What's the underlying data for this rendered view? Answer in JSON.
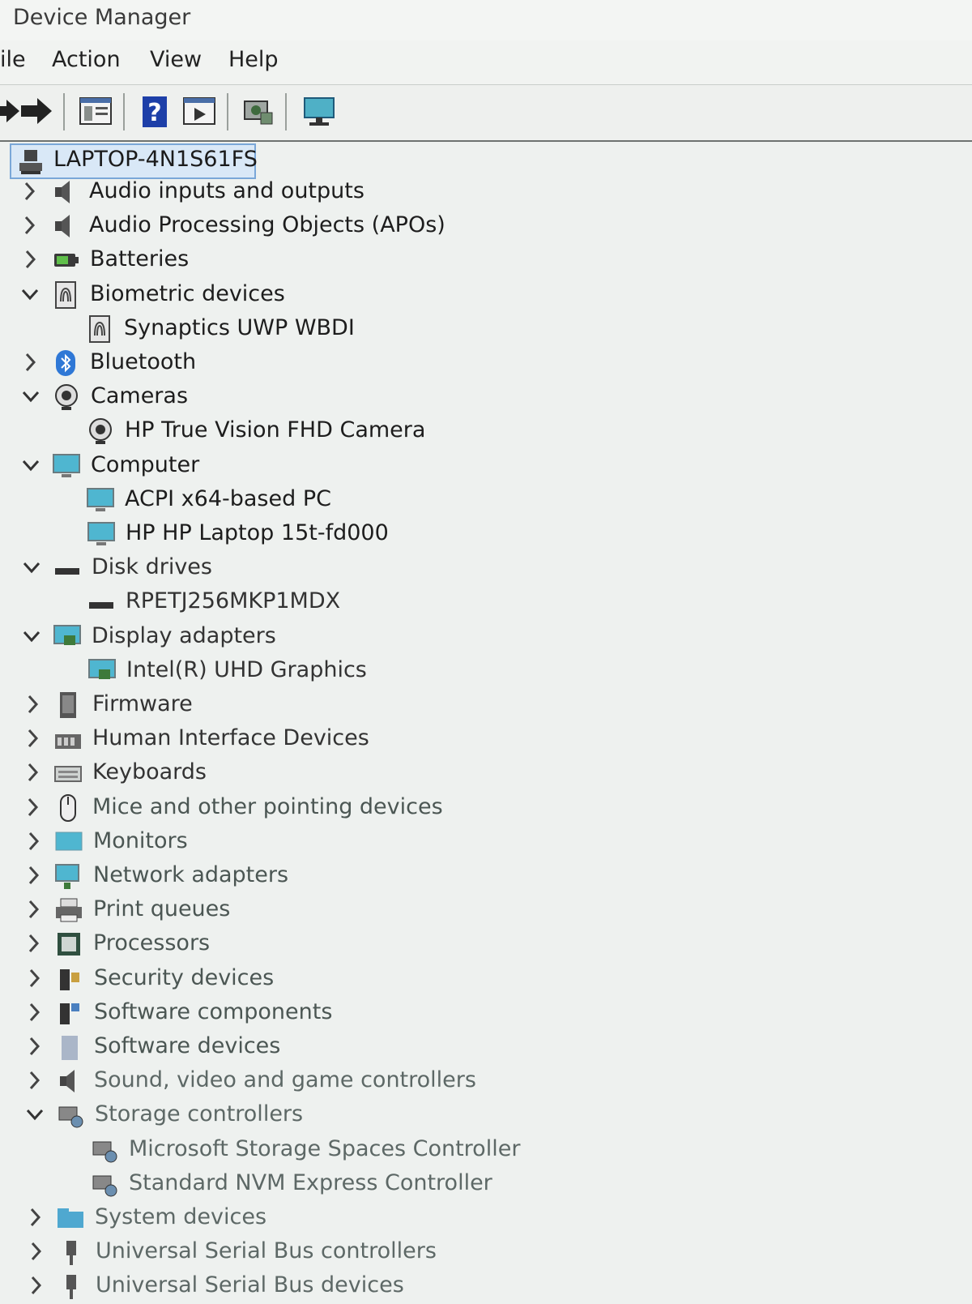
{
  "window": {
    "title": "Device Manager"
  },
  "menu": [
    "ile",
    "Action",
    "View",
    "Help"
  ],
  "tree": {
    "root": "LAPTOP-4N1S61FS",
    "categories": [
      {
        "label": "Audio inputs and outputs",
        "expanded": false,
        "icon": "speaker-icon",
        "children": []
      },
      {
        "label": "Audio Processing Objects (APOs)",
        "expanded": false,
        "icon": "speaker-icon",
        "children": []
      },
      {
        "label": "Batteries",
        "expanded": false,
        "icon": "battery-icon",
        "children": []
      },
      {
        "label": "Biometric devices",
        "expanded": true,
        "icon": "fingerprint-icon",
        "children": [
          "Synaptics UWP WBDI"
        ]
      },
      {
        "label": "Bluetooth",
        "expanded": false,
        "icon": "bluetooth-icon",
        "children": []
      },
      {
        "label": "Cameras",
        "expanded": true,
        "icon": "camera-icon",
        "children": [
          "HP True Vision FHD Camera"
        ]
      },
      {
        "label": "Computer",
        "expanded": true,
        "icon": "computer-icon",
        "children": [
          "ACPI x64-based PC",
          "HP HP Laptop 15t-fd000"
        ]
      },
      {
        "label": "Disk drives",
        "expanded": true,
        "icon": "disk-drive-icon",
        "children": [
          "RPETJ256MKP1MDX"
        ]
      },
      {
        "label": "Display adapters",
        "expanded": true,
        "icon": "display-adapter-icon",
        "children": [
          "Intel(R) UHD Graphics"
        ]
      },
      {
        "label": "Firmware",
        "expanded": false,
        "icon": "firmware-icon",
        "children": []
      },
      {
        "label": "Human Interface Devices",
        "expanded": false,
        "icon": "hid-icon",
        "children": []
      },
      {
        "label": "Keyboards",
        "expanded": false,
        "icon": "keyboard-icon",
        "children": []
      },
      {
        "label": "Mice and other pointing devices",
        "expanded": false,
        "icon": "mouse-icon",
        "children": []
      },
      {
        "label": "Monitors",
        "expanded": false,
        "icon": "monitor-icon",
        "children": []
      },
      {
        "label": "Network adapters",
        "expanded": false,
        "icon": "network-icon",
        "children": []
      },
      {
        "label": "Print queues",
        "expanded": false,
        "icon": "printer-icon",
        "children": []
      },
      {
        "label": "Processors",
        "expanded": false,
        "icon": "processor-icon",
        "children": []
      },
      {
        "label": "Security devices",
        "expanded": false,
        "icon": "security-icon",
        "children": []
      },
      {
        "label": "Software components",
        "expanded": false,
        "icon": "software-component-icon",
        "children": []
      },
      {
        "label": "Software devices",
        "expanded": false,
        "icon": "software-device-icon",
        "children": []
      },
      {
        "label": "Sound, video and game controllers",
        "expanded": false,
        "icon": "speaker-icon",
        "children": []
      },
      {
        "label": "Storage controllers",
        "expanded": true,
        "icon": "storage-controller-icon",
        "children": [
          "Microsoft Storage Spaces Controller",
          "Standard NVM Express Controller"
        ]
      },
      {
        "label": "System devices",
        "expanded": false,
        "icon": "folder-icon",
        "children": []
      },
      {
        "label": "Universal Serial Bus controllers",
        "expanded": false,
        "icon": "usb-icon",
        "children": []
      },
      {
        "label": "Universal Serial Bus devices",
        "expanded": false,
        "icon": "usb-icon",
        "children": []
      }
    ]
  }
}
